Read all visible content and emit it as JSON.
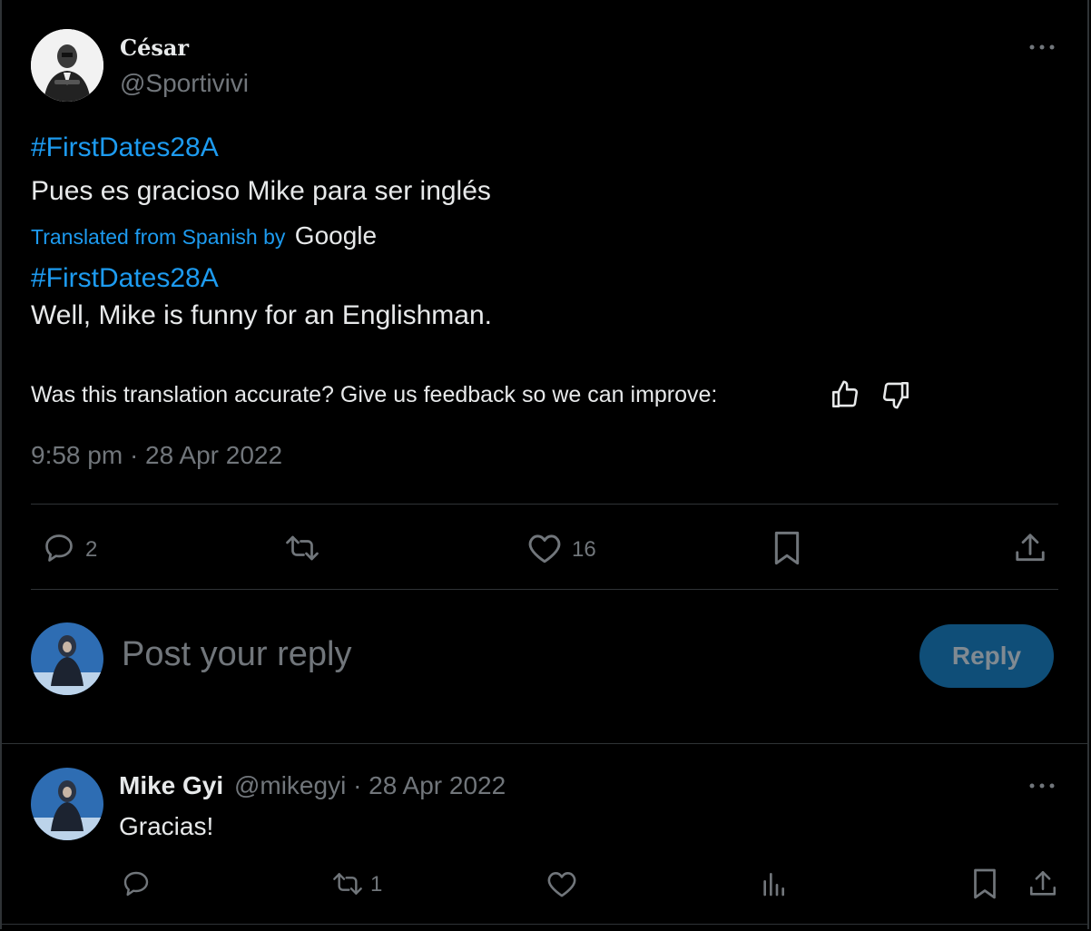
{
  "tweet": {
    "author_name": "César",
    "author_handle": "@Sportivivi",
    "hashtag": "#FirstDates28A",
    "text": "Pues es gracioso Mike para ser inglés",
    "translated_label": "Translated from Spanish by",
    "translator": "Google",
    "translated_hashtag": "#FirstDates28A",
    "translated_text": "Well, Mike is funny for an Englishman.",
    "feedback_prompt": "Was this translation accurate? Give us feedback so we can improve:",
    "timestamp": "9:58 pm · 28 Apr 2022",
    "reply_count": "2",
    "like_count": "16"
  },
  "composer": {
    "placeholder": "Post your reply",
    "reply_label": "Reply"
  },
  "reply": {
    "author_name": "Mike Gyi",
    "author_handle": "@mikegyi",
    "date": "· 28 Apr 2022",
    "text": "Gracias!",
    "retweet_count": "1"
  },
  "colors": {
    "background": "#000000",
    "accent": "#1d9bf0",
    "muted": "#71767b",
    "text": "#e7e9ea",
    "divider": "#2f3336"
  },
  "icons": [
    "more-icon",
    "reply-icon",
    "retweet-icon",
    "like-icon",
    "bookmark-icon",
    "share-icon",
    "thumbs-up-icon",
    "thumbs-down-icon",
    "views-icon"
  ]
}
